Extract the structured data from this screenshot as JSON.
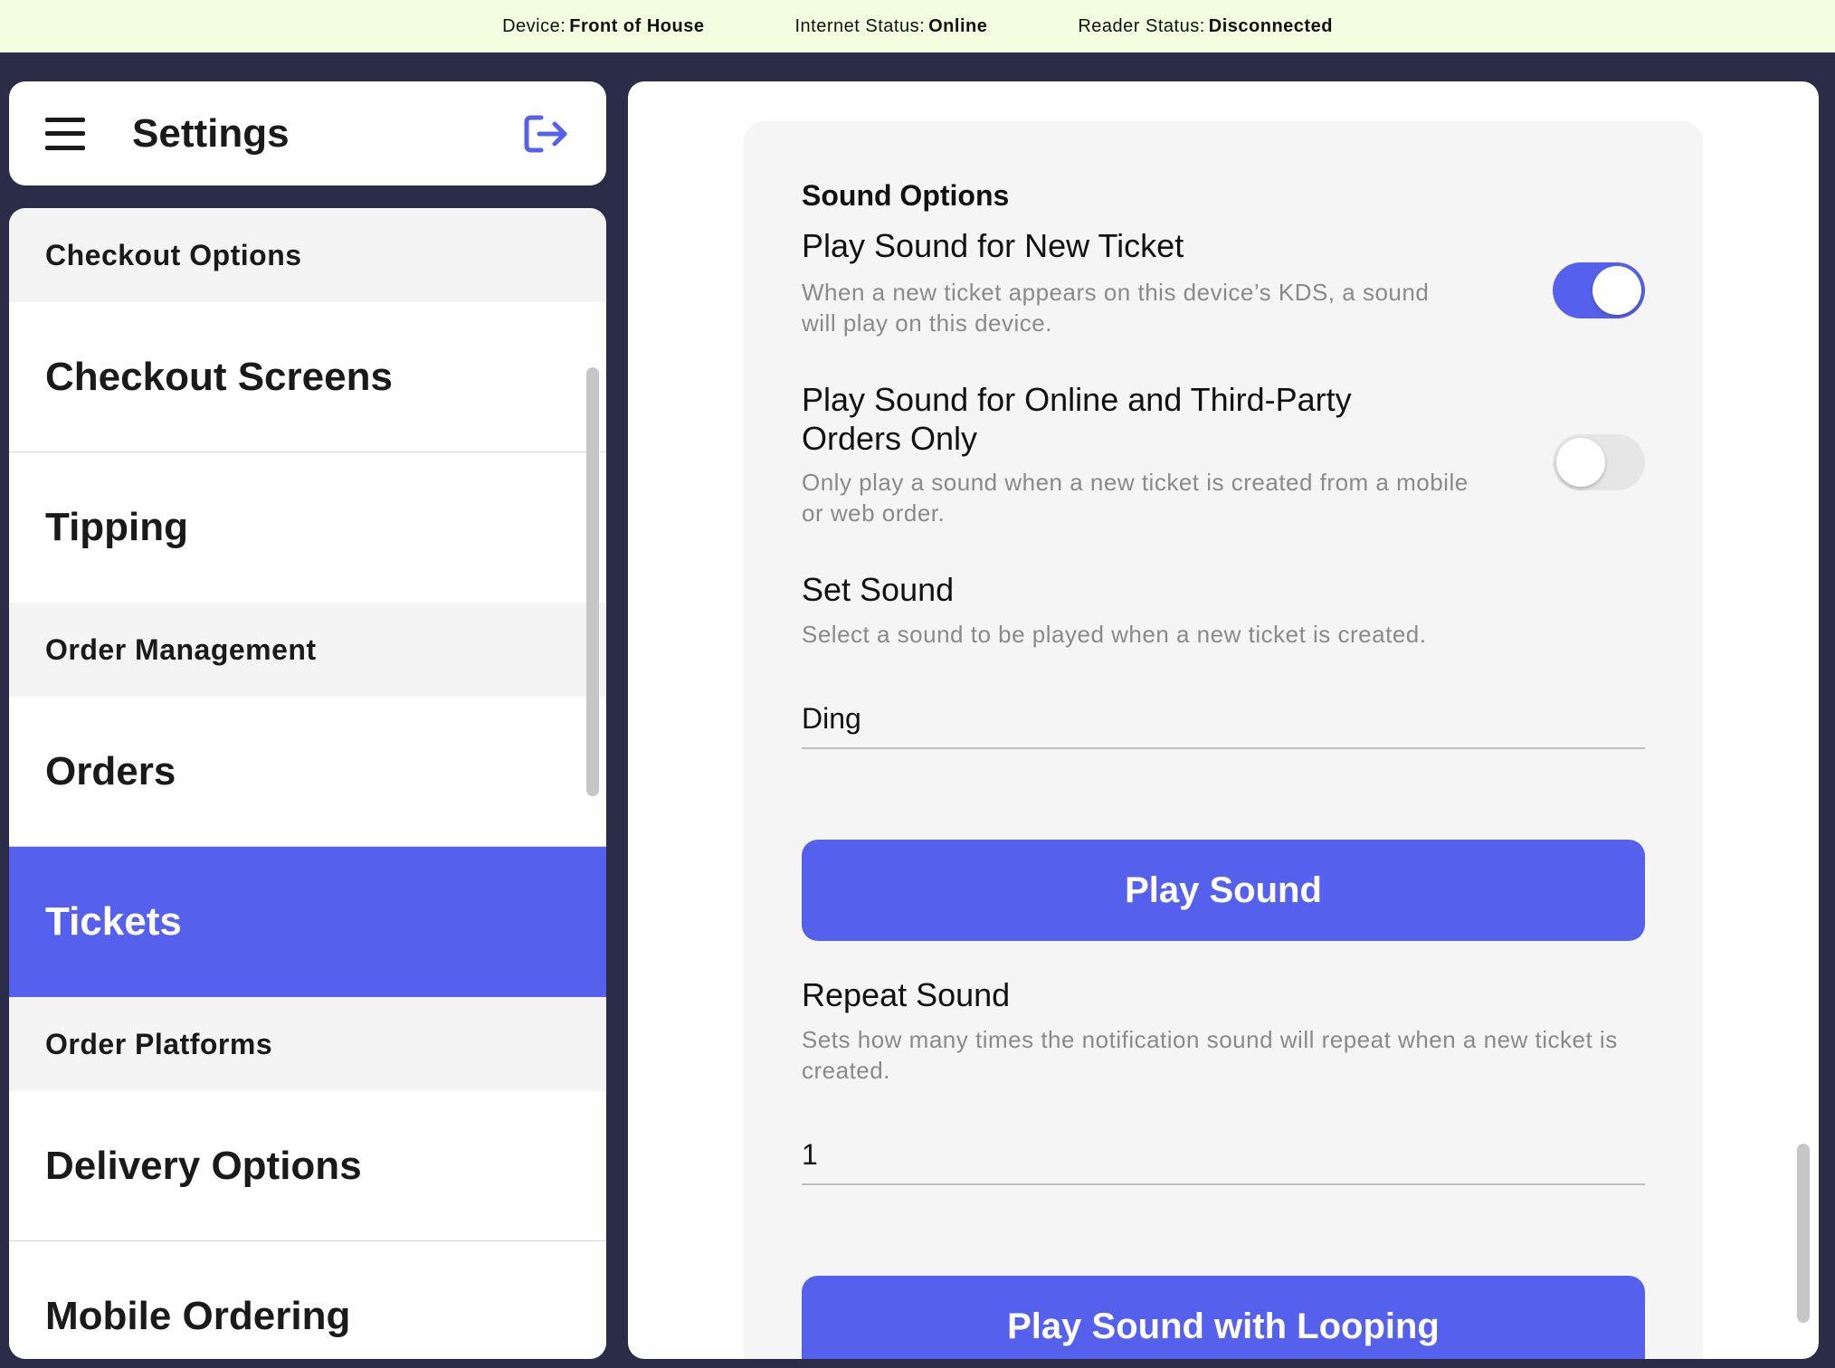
{
  "status_bar": {
    "device_label": "Device:",
    "device_value": "Front of House",
    "internet_label": "Internet Status:",
    "internet_value": "Online",
    "reader_label": "Reader Status:",
    "reader_value": "Disconnected"
  },
  "sidebar": {
    "title": "Settings",
    "menu_icon": "hamburger-menu-icon",
    "logout_icon": "logout-icon",
    "sections": [
      {
        "heading": "Checkout Options",
        "items": [
          "Checkout Screens",
          "Tipping"
        ]
      },
      {
        "heading": "Order Management",
        "items": [
          "Orders",
          "Tickets"
        ]
      },
      {
        "heading": "Order Platforms",
        "items": [
          "Delivery Options",
          "Mobile Ordering"
        ]
      }
    ],
    "active_item": "Tickets"
  },
  "main": {
    "section_title": "Sound Options",
    "new_ticket": {
      "title": "Play Sound for New Ticket",
      "description": "When a new ticket appears on this device’s KDS, a sound will play on this device.",
      "enabled": true
    },
    "online_only": {
      "title": "Play Sound for Online and Third-Party Orders Only",
      "description": "Only play a sound when a new ticket is created from a mobile or web order.",
      "enabled": false
    },
    "set_sound": {
      "title": "Set Sound",
      "description": "Select a sound to be played when a new ticket is created.",
      "value": "Ding"
    },
    "play_sound_button": "Play Sound",
    "repeat_sound": {
      "title": "Repeat Sound",
      "description": "Sets how many times the notification sound will repeat when a new ticket is created.",
      "value": "1"
    },
    "play_loop_button": "Play Sound with Looping"
  },
  "colors": {
    "accent": "#5561ec",
    "status_bg": "#f3fde0",
    "app_bg": "#2b2d48"
  }
}
